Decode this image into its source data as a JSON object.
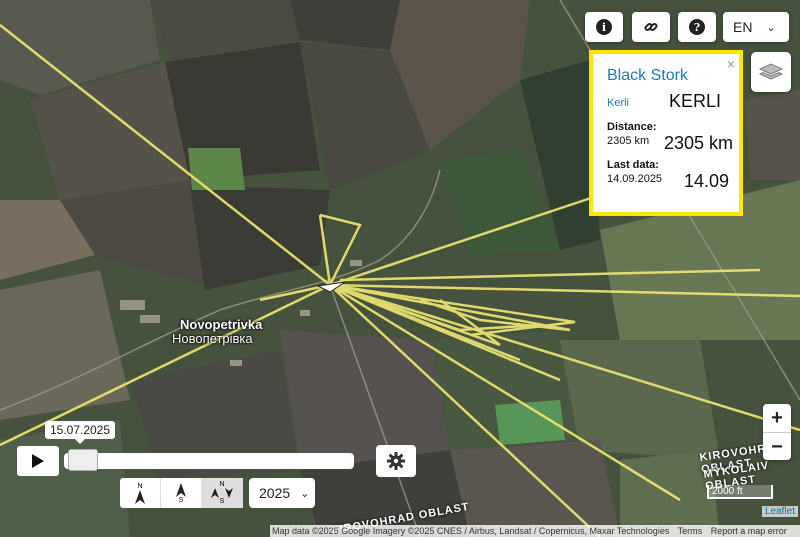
{
  "map": {
    "place_name_latin": "Novopetrivka",
    "place_name_local": "Новопетрівка",
    "oblast_1": "KIROVOHRAD OBLAST",
    "oblast_2": "MYKOLAIV OBLAST",
    "oblast_3": "KIROVOHRAD OBLAST",
    "track_color": "#e8e070"
  },
  "toolbar": {
    "info_icon": "info-icon",
    "link_icon": "link-icon",
    "help_icon": "help-icon",
    "language": "EN",
    "layers_icon": "layers-icon"
  },
  "popup": {
    "species": "Black Stork",
    "bird_name_small": "Kerli",
    "bird_name_big": "KERLI",
    "distance_label": "Distance:",
    "distance_small": "2305 km",
    "distance_big": "2305 km",
    "lastdata_label": "Last data:",
    "lastdata_small": "14.09.2025",
    "lastdata_big": "14.09",
    "close": "×"
  },
  "zoom": {
    "in": "+",
    "out": "−"
  },
  "timeline": {
    "date_tip": "15.07.2025",
    "position": 0.0,
    "year": "2025",
    "arrow_n": "N",
    "arrow_s": "S"
  },
  "scale": {
    "label": "2000 ft"
  },
  "attribution": {
    "map_data": "Map data ©2025 Google Imagery ©2025 CNES / Airbus, Landsat / Copernicus, Maxar Technologies",
    "terms": "Terms",
    "report": "Report a map error",
    "leaflet": "Leaflet"
  }
}
